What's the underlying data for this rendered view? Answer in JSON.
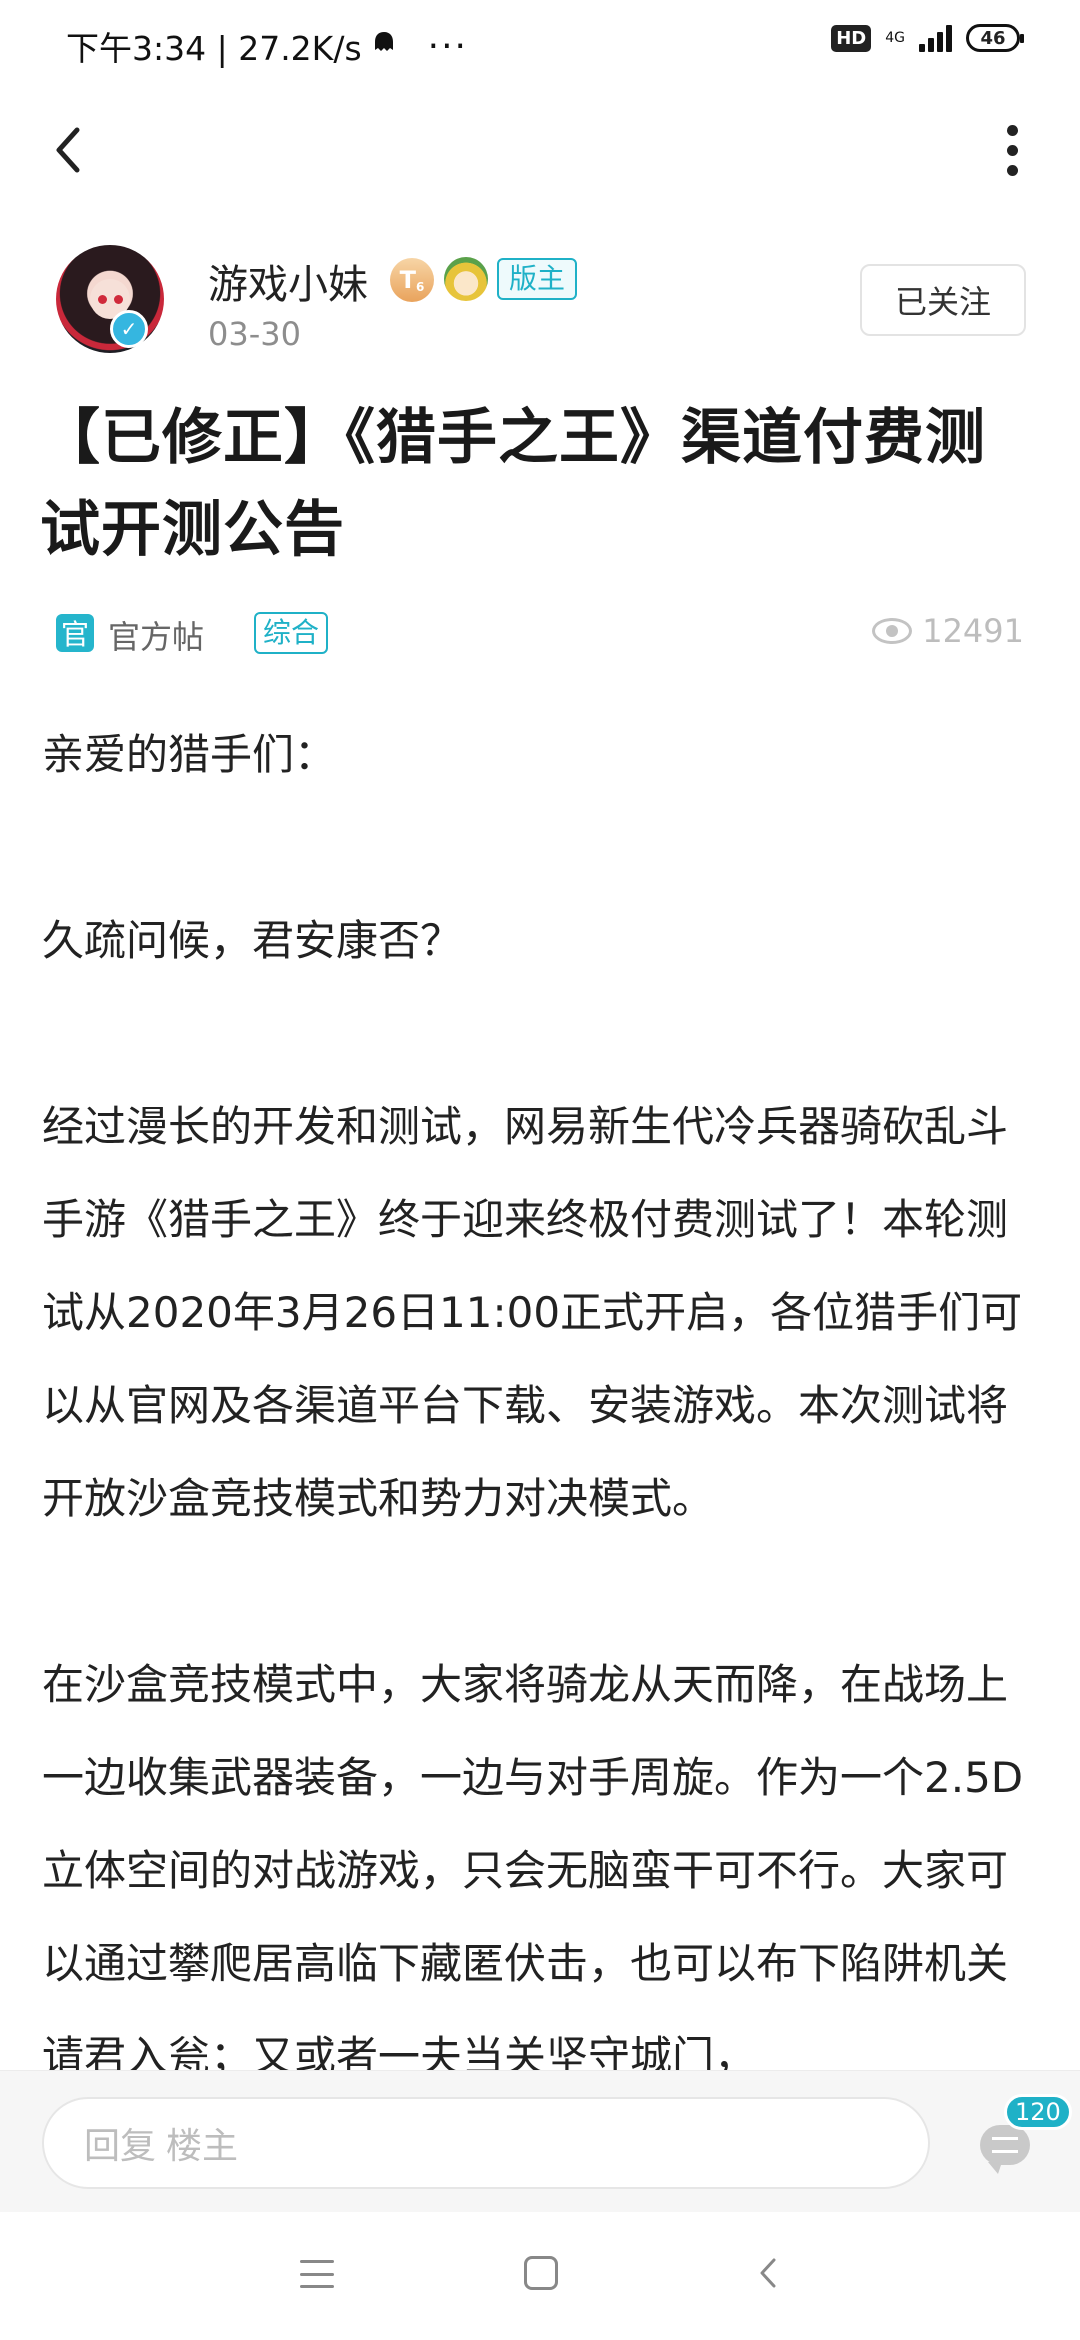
{
  "status_bar": {
    "time_speed": "下午3:34 | 27.2K/s",
    "dots": "···",
    "hd": "HD",
    "network": "4G",
    "battery": "46"
  },
  "author": {
    "name": "游戏小妹",
    "level": "T",
    "level_sub": "6",
    "role": "版主",
    "date": "03-30",
    "follow_label": "已关注"
  },
  "post": {
    "title": "【已修正】《猎手之王》渠道付费测试开测公告",
    "official_icon": "官",
    "official_label": "官方帖",
    "category": "综合",
    "views": "12491",
    "body": [
      "亲爱的猎手们：",
      "",
      "久疏问候，君安康否？",
      "",
      "经过漫长的开发和测试，网易新生代冷兵器骑砍乱斗手游《猎手之王》终于迎来终极付费测试了！本轮测试从2020年3月26日11:00正式开启，各位猎手们可以从官网及各渠道平台下载、安装游戏。本次测试将开放沙盒竞技模式和势力对决模式。",
      "",
      "在沙盒竞技模式中，大家将骑龙从天而降，在战场上一边收集武器装备，一边与对手周旋。作为一个2.5D立体空间的对战游戏，只会无脑蛮干可不行。大家可以通过攀爬居高临下藏匿伏击，也可以布下陷阱机关请君入瓮；又或者一夫当关坚守城门，"
    ]
  },
  "reply_bar": {
    "placeholder": "回复  楼主",
    "comment_count": "120"
  },
  "colors": {
    "accent": "#1fb1c7",
    "text": "#222222",
    "muted": "#8d8d8d"
  }
}
